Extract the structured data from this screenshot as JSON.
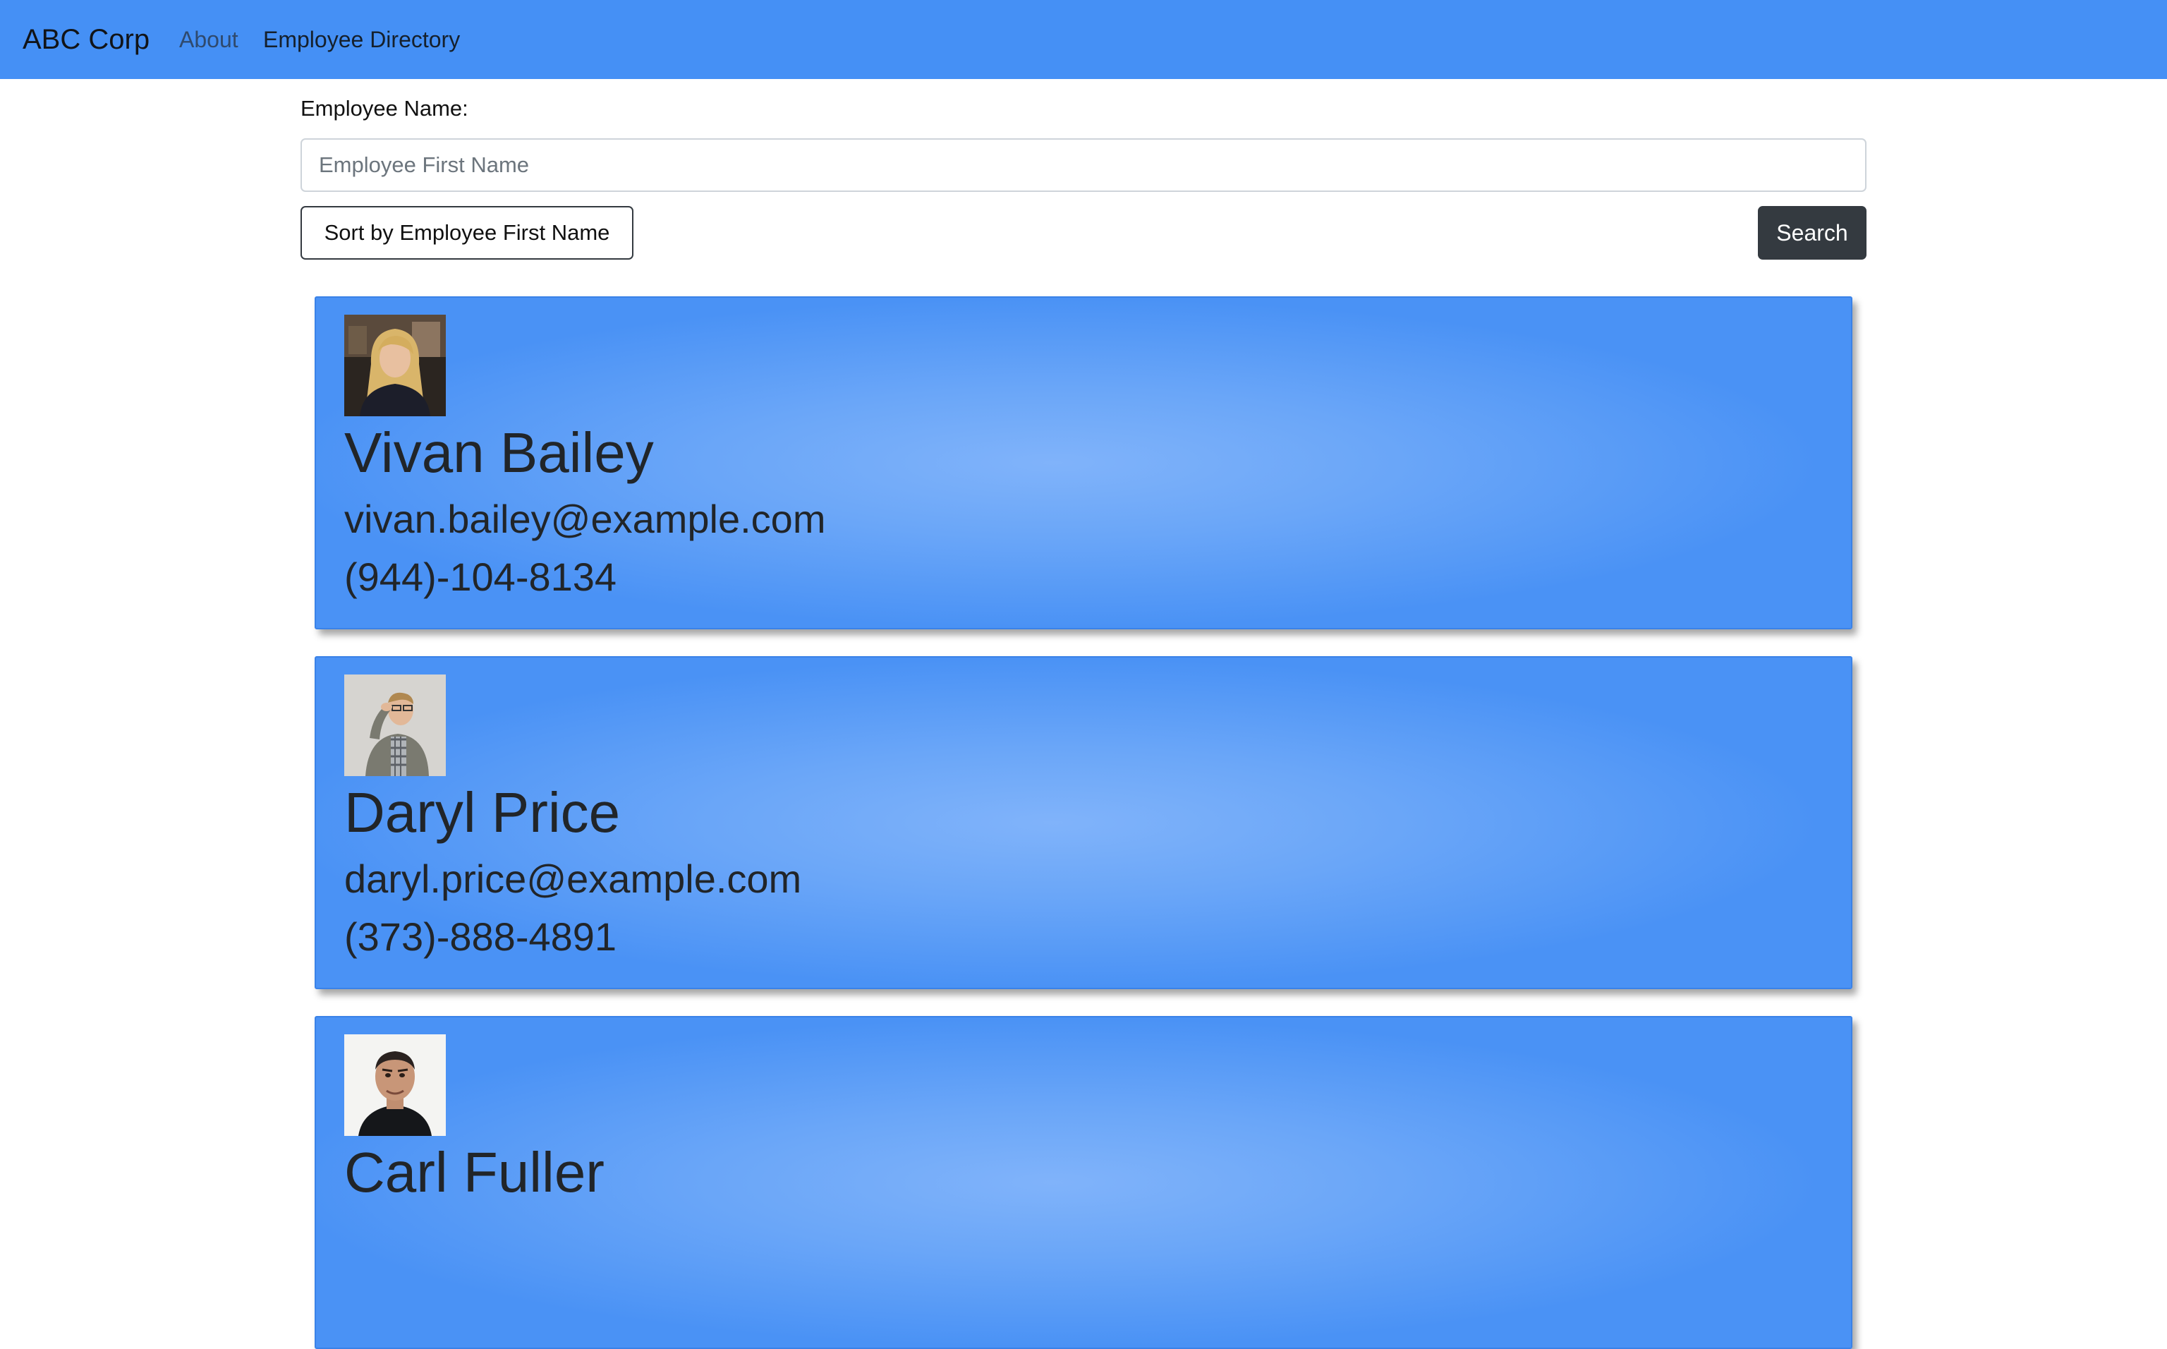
{
  "navbar": {
    "brand": "ABC Corp",
    "links": [
      {
        "label": "About"
      },
      {
        "label": "Employee Directory"
      }
    ],
    "background": "#4590f5"
  },
  "search": {
    "label": "Employee Name:",
    "placeholder": "Employee First Name",
    "value": "",
    "sort_button": "Sort by Employee First Name",
    "search_button": "Search"
  },
  "employees": [
    {
      "name": "Vivan Bailey",
      "email": "vivan.bailey@example.com",
      "phone": "(944)-104-8134",
      "photo_icon": "woman-portrait-icon"
    },
    {
      "name": "Daryl Price",
      "email": "daryl.price@example.com",
      "phone": "(373)-888-4891",
      "photo_icon": "man-portrait-icon"
    },
    {
      "name": "Carl Fuller",
      "email": "",
      "phone": "",
      "photo_icon": "man-portrait-icon"
    }
  ],
  "colors": {
    "accent": "#4590f5",
    "card_highlight": "#80b3fa",
    "dark_button": "#343a40"
  }
}
